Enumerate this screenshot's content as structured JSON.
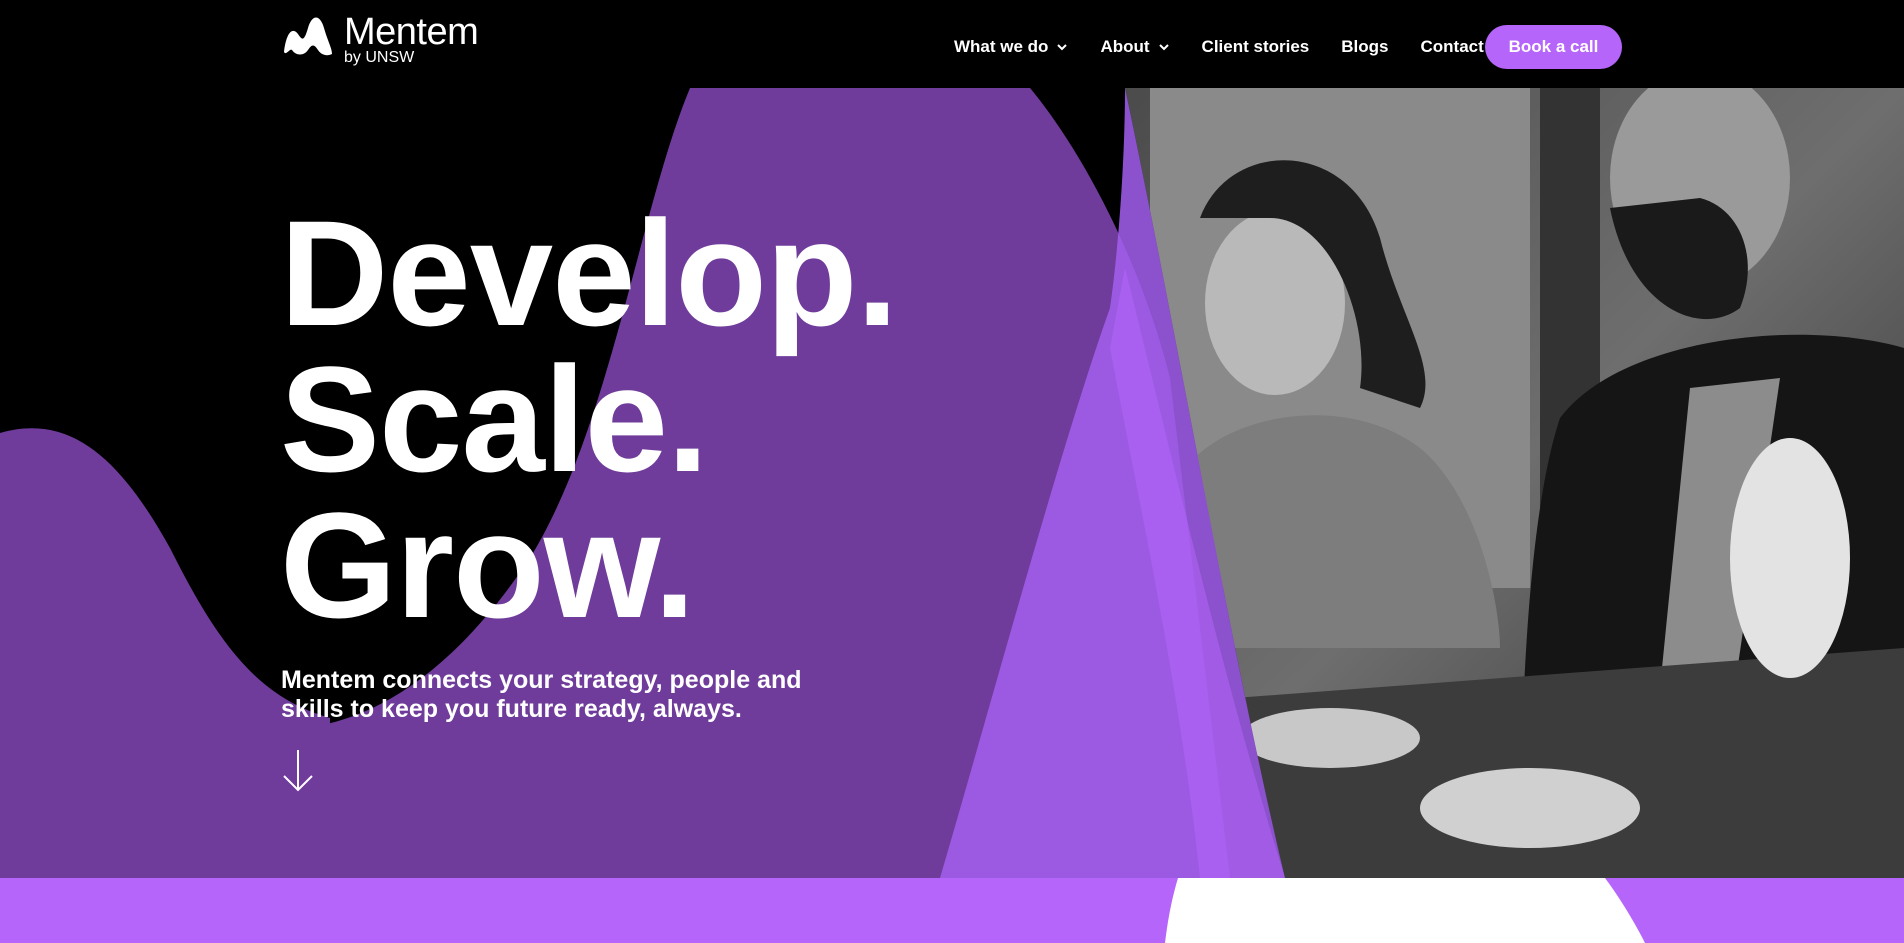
{
  "header": {
    "logo_name": "Mentem",
    "logo_sub": "by UNSW",
    "nav": [
      {
        "label": "What we do",
        "has_dropdown": true
      },
      {
        "label": "About",
        "has_dropdown": true
      },
      {
        "label": "Client stories",
        "has_dropdown": false
      },
      {
        "label": "Blogs",
        "has_dropdown": false
      },
      {
        "label": "Contact",
        "has_dropdown": false
      }
    ],
    "cta_label": "Book a call"
  },
  "hero": {
    "headline": [
      "Develop.",
      "Scale.",
      "Grow."
    ],
    "subtext": "Mentem connects your strategy, people and skills to keep you future ready, always.",
    "scroll_icon": "arrow-down-icon",
    "image_description_icon": "meeting-photo"
  },
  "colors": {
    "background": "#000000",
    "purple_dark": "#6f3c9b",
    "purple_light": "#b565fa",
    "text": "#ffffff"
  }
}
